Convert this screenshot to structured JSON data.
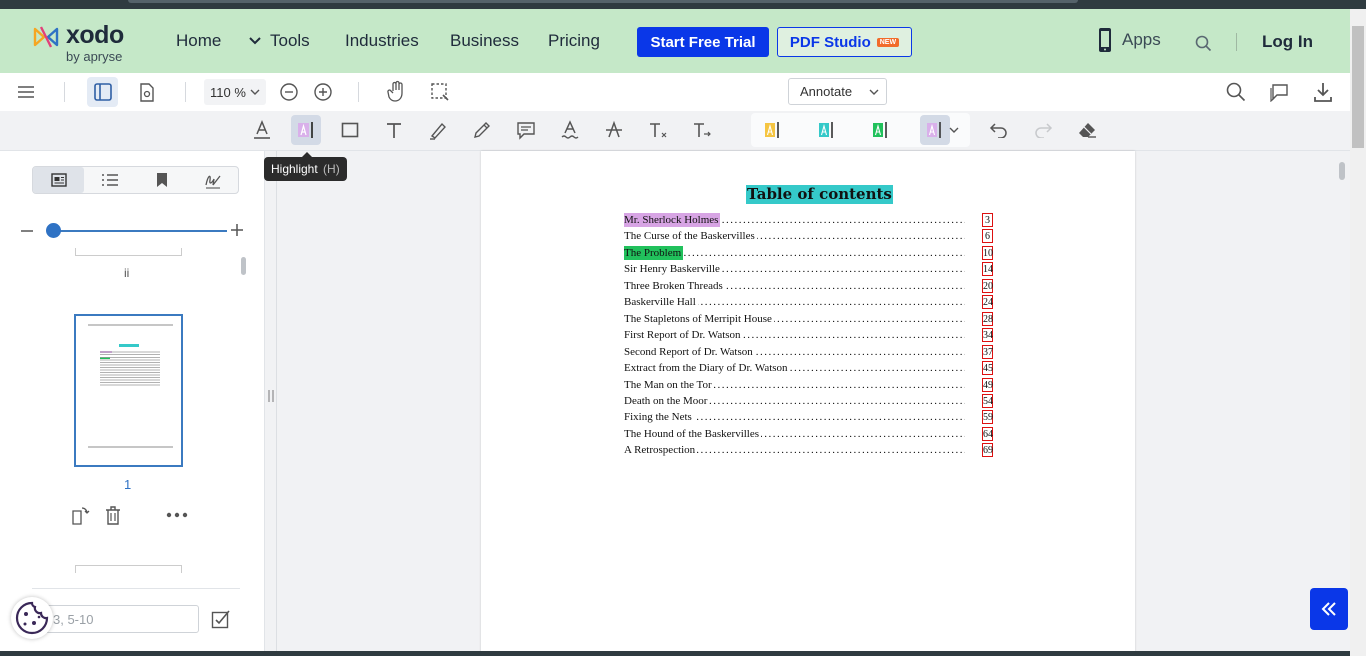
{
  "site_nav": {
    "logo_word": "xodo",
    "logo_by": "by apryse",
    "links": [
      "Home",
      "Tools",
      "Industries",
      "Business",
      "Pricing"
    ],
    "trial_button": "Start Free Trial",
    "studio_button": "PDF Studio",
    "studio_badge": "NEW",
    "apps_label": "Apps",
    "login_label": "Log In"
  },
  "viewer_header": {
    "zoom_value": "110 %",
    "mode_select": "Annotate"
  },
  "tooltip": {
    "label": "Highlight",
    "shortcut": "(H)"
  },
  "left_panel": {
    "prev_page_label": "ii",
    "current_page_number": "1",
    "page_input_placeholder": "3, 5-10"
  },
  "document": {
    "toc_title": "Table of contents",
    "entries": [
      {
        "title": "Mr. Sherlock Holmes",
        "page": "3",
        "highlight": "pink"
      },
      {
        "title": "The Curse of the Baskervilles",
        "page": "6",
        "highlight": "none"
      },
      {
        "title": "The Problem",
        "page": "10",
        "highlight": "green"
      },
      {
        "title": "Sir Henry Baskerville",
        "page": "14",
        "highlight": "none"
      },
      {
        "title": "Three Broken Threads",
        "page": "20",
        "highlight": "none"
      },
      {
        "title": "Baskerville Hall",
        "page": "24",
        "highlight": "none"
      },
      {
        "title": "The Stapletons of Merripit House",
        "page": "28",
        "highlight": "none"
      },
      {
        "title": "First Report of Dr. Watson",
        "page": "34",
        "highlight": "none"
      },
      {
        "title": "Second Report of Dr. Watson",
        "page": "37",
        "highlight": "none"
      },
      {
        "title": "Extract from the Diary of Dr. Watson",
        "page": "45",
        "highlight": "none"
      },
      {
        "title": "The Man on the Tor",
        "page": "49",
        "highlight": "none"
      },
      {
        "title": "Death on the Moor",
        "page": "54",
        "highlight": "none"
      },
      {
        "title": "Fixing the Nets",
        "page": "59",
        "highlight": "none"
      },
      {
        "title": "The Hound of the Baskervilles",
        "page": "64",
        "highlight": "none"
      },
      {
        "title": "A Retrospection",
        "page": "69",
        "highlight": "none"
      }
    ]
  },
  "colors": {
    "nav_bg": "#c5e8c8",
    "brand_blue": "#0a37e8",
    "toc_title_bg": "#35c9c9",
    "highlight_pink": "#d7a4e4",
    "highlight_green": "#21c15c",
    "page_box_red": "#dd1111"
  }
}
